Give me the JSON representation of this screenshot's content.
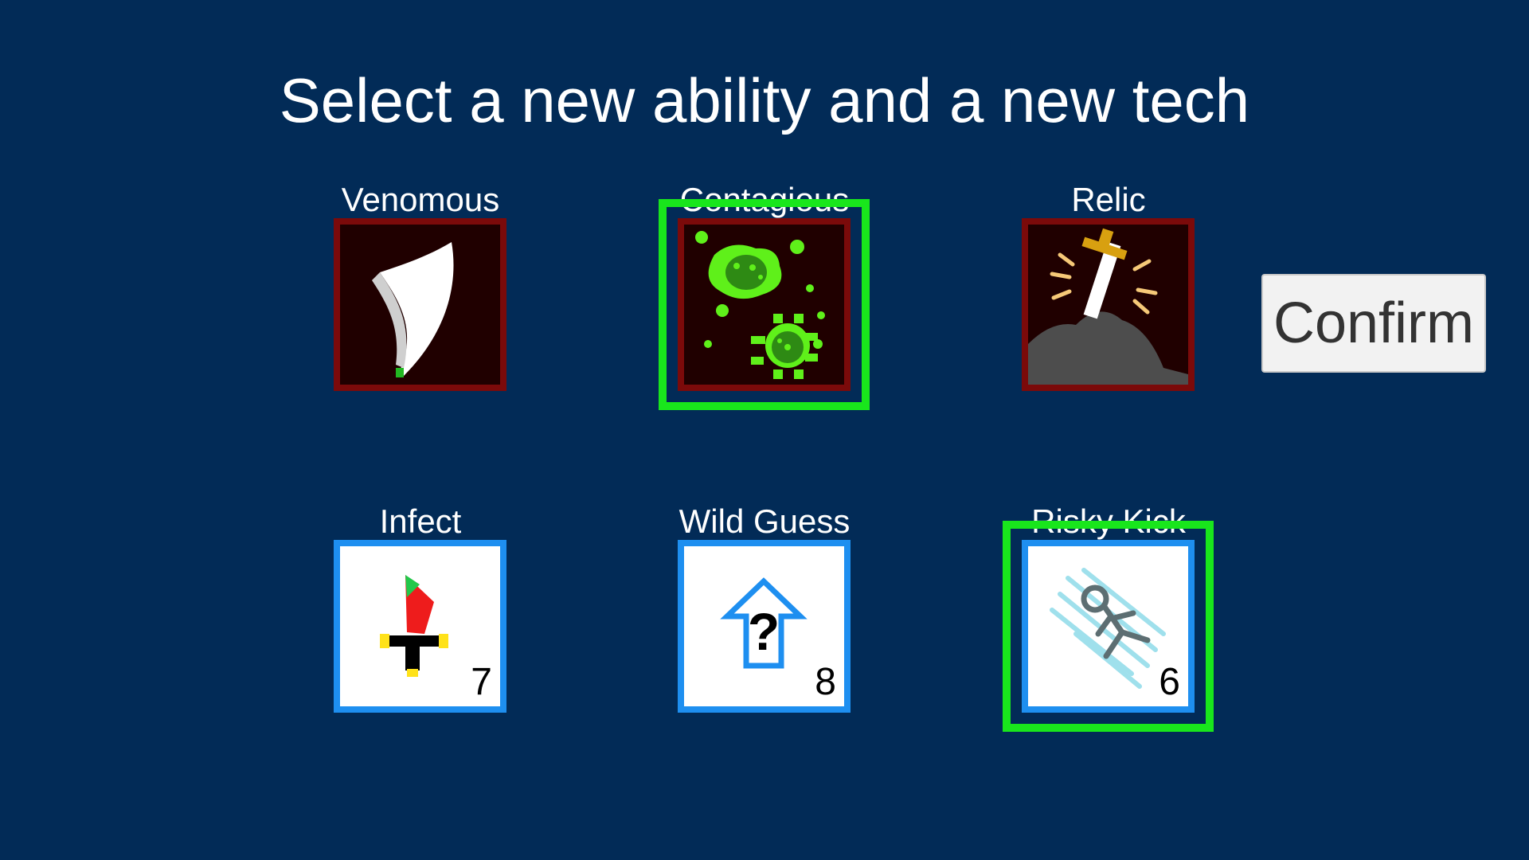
{
  "title": "Select a new ability and a new tech",
  "abilities": [
    {
      "name": "Venomous",
      "icon": "fang-icon",
      "selected": false
    },
    {
      "name": "Contagious",
      "icon": "virus-icon",
      "selected": true
    },
    {
      "name": "Relic",
      "icon": "sword-in-stone-icon",
      "selected": false
    }
  ],
  "techs": [
    {
      "name": "Infect",
      "cost": "7",
      "icon": "dagger-icon",
      "selected": false
    },
    {
      "name": "Wild Guess",
      "cost": "8",
      "icon": "question-arrow-icon",
      "selected": false
    },
    {
      "name": "Risky Kick",
      "cost": "6",
      "icon": "kick-icon",
      "selected": true
    }
  ],
  "confirm_label": "Confirm",
  "colors": {
    "background": "#022b57",
    "ability_border": "#7b0a0a",
    "tech_border": "#1e8ff0",
    "selection": "#19e61c"
  }
}
